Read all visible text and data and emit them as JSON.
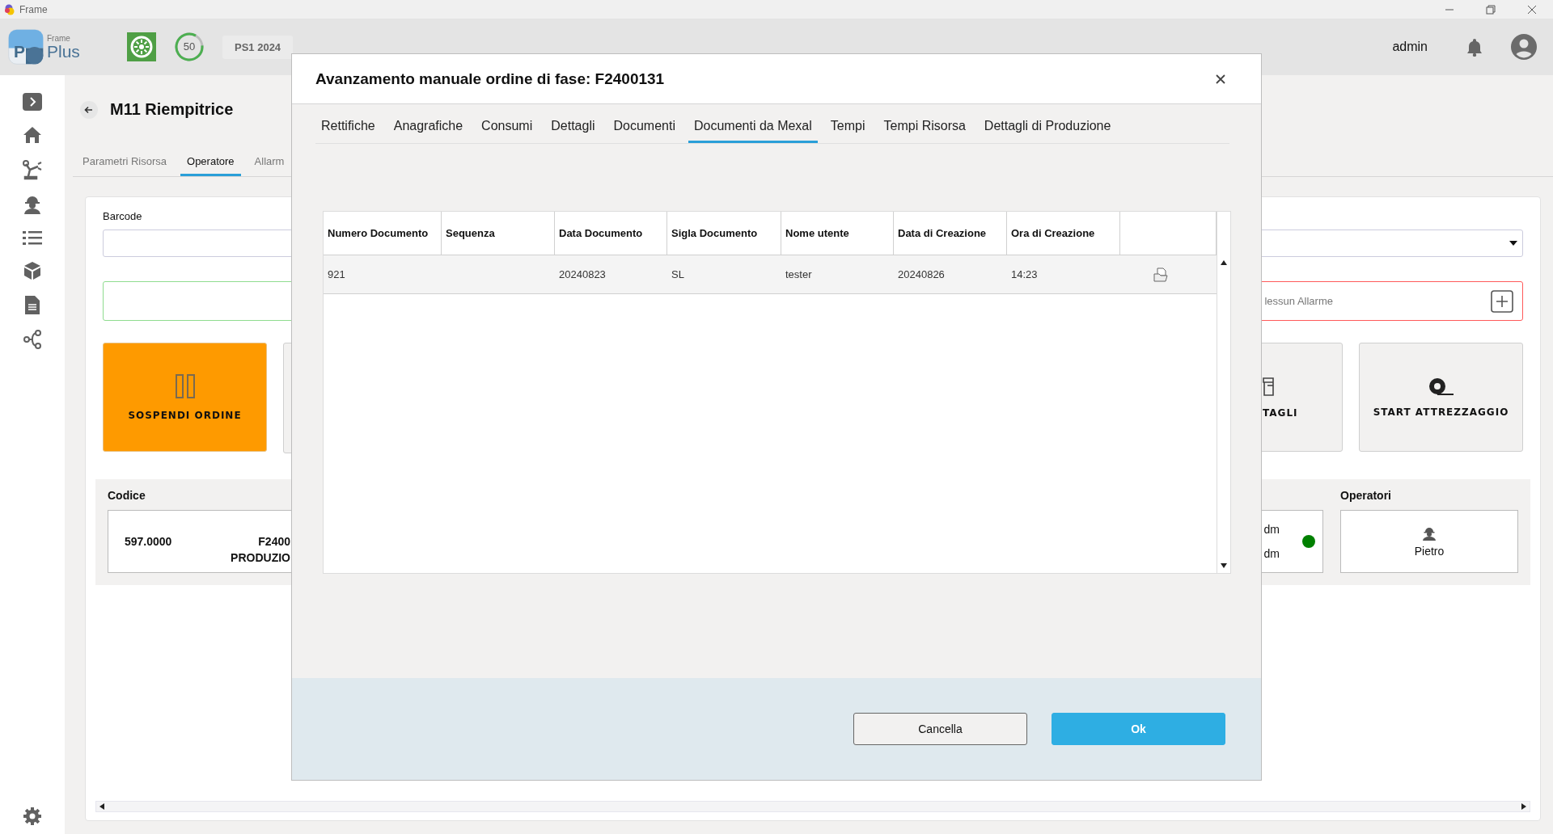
{
  "titlebar": {
    "title": "Frame"
  },
  "header": {
    "logo": {
      "small": "Frame",
      "big": "Plus",
      "letter": "P"
    },
    "progress": {
      "label": "50",
      "level": 0.85
    },
    "period": "PS1 2024",
    "user": "admin"
  },
  "page": {
    "title": "M11 Riempitrice",
    "tabs": [
      {
        "label": "Parametri Risorsa",
        "selected": false
      },
      {
        "label": "Operatore",
        "selected": true
      },
      {
        "label": "Allarm",
        "selected": false
      }
    ],
    "barcode": {
      "label": "Barcode"
    },
    "alarm": {
      "text": "lessun Allarme"
    },
    "actions": [
      {
        "kind": "suspend",
        "label": "SOSPENDI ORDINE"
      },
      {
        "kind": "blank"
      },
      {
        "kind": "details",
        "label": "TAGLI"
      },
      {
        "kind": "setup",
        "label": "START ATTREZZAGGIO"
      }
    ],
    "info": {
      "code_label": "Codice",
      "code": "597.0000",
      "order": "F2400",
      "phase": "PRODUZIO",
      "status_lines": [
        "dm",
        "dm"
      ],
      "active": true,
      "operators_label": "Operatori",
      "operator": "Pietro"
    }
  },
  "dialog": {
    "title": "Avanzamento manuale ordine di fase: F2400131",
    "tabs": [
      {
        "label": "Rettifiche",
        "selected": false
      },
      {
        "label": "Anagrafiche",
        "selected": false
      },
      {
        "label": "Consumi",
        "selected": false
      },
      {
        "label": "Dettagli",
        "selected": false
      },
      {
        "label": "Documenti",
        "selected": false
      },
      {
        "label": "Documenti da Mexal",
        "selected": true
      },
      {
        "label": "Tempi",
        "selected": false
      },
      {
        "label": "Tempi Risorsa",
        "selected": false
      },
      {
        "label": "Dettagli di Produzione",
        "selected": false
      }
    ],
    "table": {
      "columns": [
        "Numero Documento",
        "Sequenza",
        "Data Documento",
        "Sigla Documento",
        "Nome utente",
        "Data di Creazione",
        "Ora di Creazione"
      ],
      "rows": [
        [
          "921",
          null,
          "20240823",
          "SL",
          "tester",
          "20240826",
          "14:23"
        ]
      ]
    },
    "buttons": [
      {
        "kind": "secondary",
        "label": "Cancella"
      },
      {
        "kind": "primary",
        "label": "Ok"
      }
    ]
  }
}
